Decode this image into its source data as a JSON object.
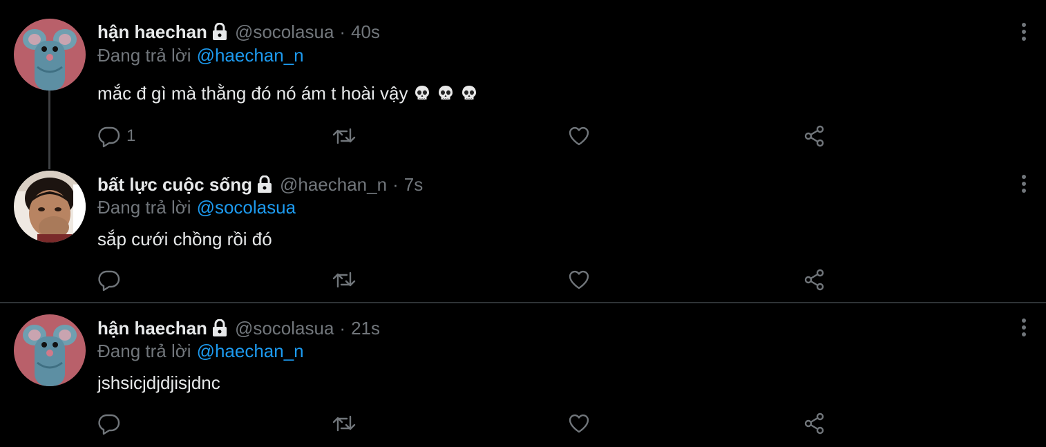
{
  "tweets": [
    {
      "display_name": "hận haechan",
      "handle": "@socolasua",
      "separator": "·",
      "time": "40s",
      "reply_prefix": "Đang trả lời",
      "reply_to": "@haechan_n",
      "text": "mắc đ gì mà thằng đó nó ám t hoài vậy",
      "emoji": [
        "skull-emoji",
        "skull-emoji",
        "skull-emoji"
      ],
      "reply_count": "1",
      "retweet_count": "",
      "like_count": ""
    },
    {
      "display_name": "bất lực cuộc sống",
      "handle": "@haechan_n",
      "separator": "·",
      "time": "7s",
      "reply_prefix": "Đang trả lời",
      "reply_to": "@socolasua",
      "text": "sắp cưới chồng rồi đó",
      "reply_count": "",
      "retweet_count": "",
      "like_count": ""
    },
    {
      "display_name": "hận haechan",
      "handle": "@socolasua",
      "separator": "·",
      "time": "21s",
      "reply_prefix": "Đang trả lời",
      "reply_to": "@haechan_n",
      "text": "jshsicjdjdjisjdnc",
      "reply_count": "",
      "retweet_count": "",
      "like_count": ""
    }
  ],
  "icons": {
    "lock": "lock-icon",
    "reply": "reply-icon",
    "retweet": "retweet-icon",
    "like": "heart-icon",
    "share": "share-icon",
    "more": "more-vertical-icon"
  },
  "colors": {
    "background": "#000000",
    "text_primary": "#e7e9ea",
    "text_secondary": "#71767b",
    "accent": "#1d9bf0",
    "divider": "#2f3336"
  }
}
